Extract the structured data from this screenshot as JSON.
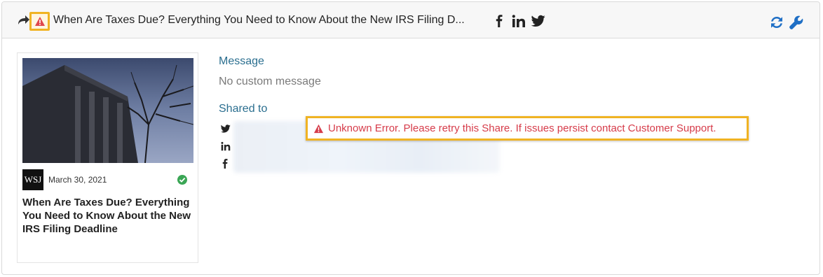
{
  "header": {
    "title": "When Are Taxes Due? Everything You Need to Know About the New IRS Filing D...",
    "icons": [
      "share-arrow-icon",
      "warning-icon",
      "facebook-icon",
      "linkedin-icon",
      "twitter-icon",
      "refresh-icon",
      "wrench-icon"
    ]
  },
  "article": {
    "source_logo": "WSJ",
    "date": "March 30, 2021",
    "title": "When Are Taxes Due? Everything You Need to Know About the New IRS Filing Deadline"
  },
  "details": {
    "message_label": "Message",
    "message_value": "No custom message",
    "shared_to_label": "Shared to",
    "networks": [
      "twitter",
      "linkedin",
      "facebook"
    ]
  },
  "error": {
    "text": "Unknown Error. Please retry this Share. If issues persist contact Customer Support."
  },
  "colors": {
    "highlight": "#f0b323",
    "error": "#d63c4a",
    "label": "#2a6e8f",
    "action_blue": "#1f6fc5",
    "success": "#3aa655"
  }
}
